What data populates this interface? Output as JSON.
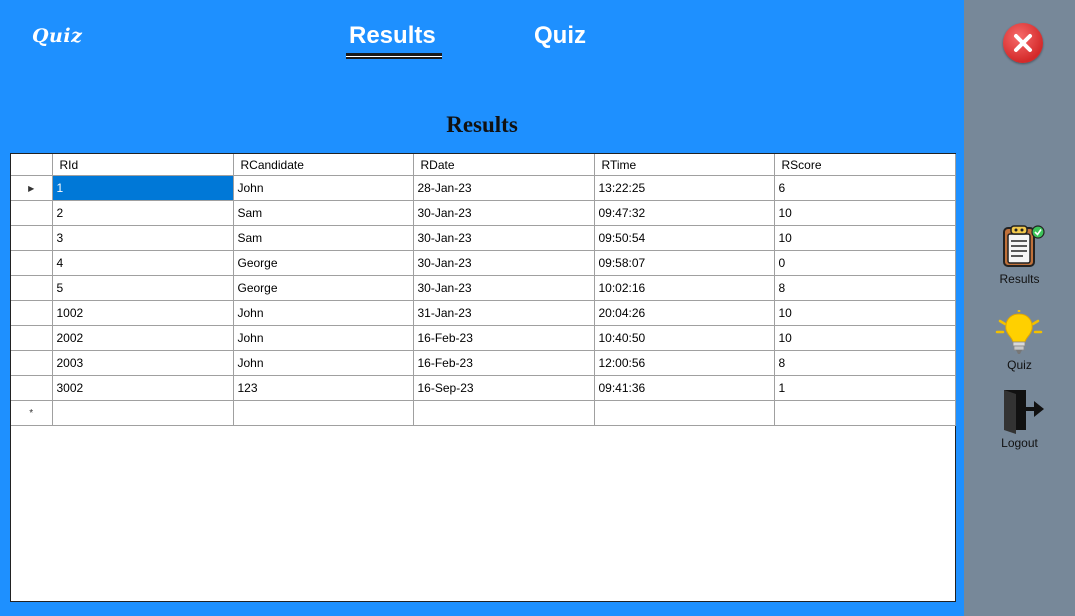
{
  "header": {
    "logo": "Quiz",
    "tabs": [
      {
        "label": "Results",
        "active": true
      },
      {
        "label": "Quiz",
        "active": false
      }
    ]
  },
  "main": {
    "title": "Results",
    "grid": {
      "columns": [
        "RId",
        "RCandidate",
        "RDate",
        "RTime",
        "RScore"
      ],
      "rows": [
        {
          "RId": "1",
          "RCandidate": "John",
          "RDate": "28-Jan-23",
          "RTime": "13:22:25",
          "RScore": "6"
        },
        {
          "RId": "2",
          "RCandidate": "Sam",
          "RDate": "30-Jan-23",
          "RTime": "09:47:32",
          "RScore": "10"
        },
        {
          "RId": "3",
          "RCandidate": "Sam",
          "RDate": "30-Jan-23",
          "RTime": "09:50:54",
          "RScore": "10"
        },
        {
          "RId": "4",
          "RCandidate": "George",
          "RDate": "30-Jan-23",
          "RTime": "09:58:07",
          "RScore": "0"
        },
        {
          "RId": "5",
          "RCandidate": "George",
          "RDate": "30-Jan-23",
          "RTime": "10:02:16",
          "RScore": "8"
        },
        {
          "RId": "1002",
          "RCandidate": "John",
          "RDate": "31-Jan-23",
          "RTime": "20:04:26",
          "RScore": "10"
        },
        {
          "RId": "2002",
          "RCandidate": "John",
          "RDate": "16-Feb-23",
          "RTime": "10:40:50",
          "RScore": "10"
        },
        {
          "RId": "2003",
          "RCandidate": "John",
          "RDate": "16-Feb-23",
          "RTime": "12:00:56",
          "RScore": "8"
        },
        {
          "RId": "3002",
          "RCandidate": "123",
          "RDate": "16-Sep-23",
          "RTime": "09:41:36",
          "RScore": "1"
        }
      ],
      "selected_row": 0,
      "current_row_marker": "▶",
      "new_row_marker": "*"
    }
  },
  "sidebar": {
    "close_icon": "close-icon",
    "items": [
      {
        "label": "Results",
        "icon": "clipboard-check-icon"
      },
      {
        "label": "Quiz",
        "icon": "lightbulb-icon"
      },
      {
        "label": "Logout",
        "icon": "logout-door-icon"
      }
    ]
  },
  "colors": {
    "header_bg": "#1e90ff",
    "sidebar_bg": "#778899",
    "selection": "#0078d7",
    "close_red": "#e03c3c"
  }
}
